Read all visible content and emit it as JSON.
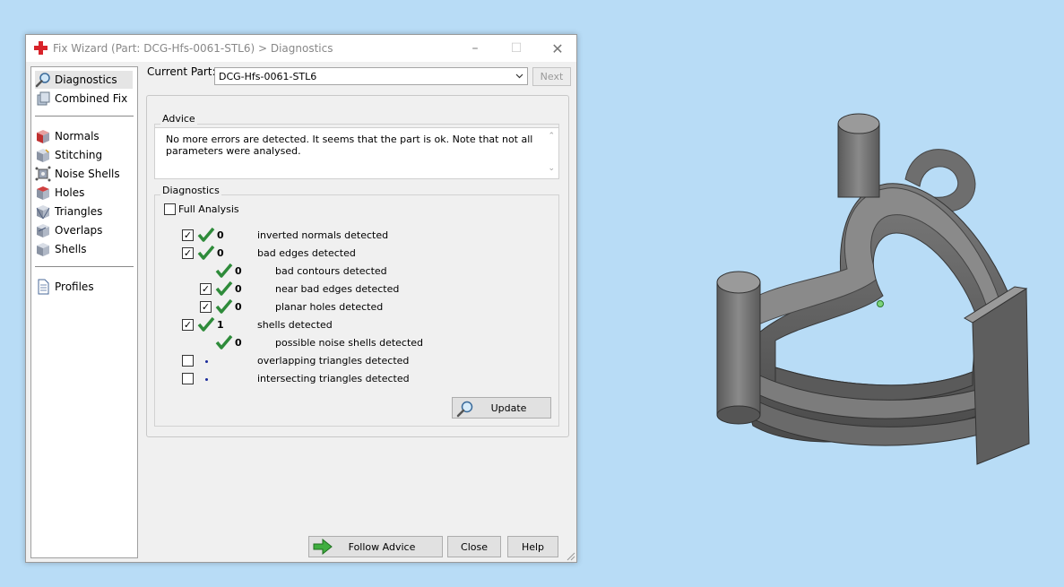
{
  "window": {
    "title": "Fix Wizard (Part: DCG-Hfs-0061-STL6) > Diagnostics",
    "minimize": "–",
    "maximize": "☐",
    "close": "✕"
  },
  "sidebar": {
    "items": [
      {
        "label": "Diagnostics",
        "icon": "magnifier-icon"
      },
      {
        "label": "Combined Fix",
        "icon": "combined-fix-icon"
      },
      {
        "label": "Normals",
        "icon": "normals-cube-icon"
      },
      {
        "label": "Stitching",
        "icon": "stitching-cube-icon"
      },
      {
        "label": "Noise Shells",
        "icon": "noise-shells-icon"
      },
      {
        "label": "Holes",
        "icon": "holes-cube-icon"
      },
      {
        "label": "Triangles",
        "icon": "triangles-cube-icon"
      },
      {
        "label": "Overlaps",
        "icon": "overlaps-cube-icon"
      },
      {
        "label": "Shells",
        "icon": "shells-cube-icon"
      },
      {
        "label": "Profiles",
        "icon": "document-icon"
      }
    ]
  },
  "current_part": {
    "label": "Current Part:",
    "value": "DCG-Hfs-0061-STL6",
    "next_label": "Next"
  },
  "advice": {
    "title": "Advice",
    "text": "No more errors are detected. It seems that the part is ok. Note that not all parameters were analysed."
  },
  "diagnostics": {
    "title": "Diagnostics",
    "full_analysis_label": "Full Analysis",
    "rows": [
      {
        "checked": true,
        "status": "ok",
        "value": "0",
        "label": "inverted normals detected"
      },
      {
        "checked": true,
        "status": "ok",
        "value": "0",
        "label": "bad edges detected"
      },
      {
        "checkbox": false,
        "status": "ok",
        "value": "0",
        "label": "bad contours detected"
      },
      {
        "checked": true,
        "status": "ok",
        "value": "0",
        "label": "near bad edges detected"
      },
      {
        "checked": true,
        "status": "ok",
        "value": "0",
        "label": "planar holes detected"
      },
      {
        "checked": true,
        "status": "ok",
        "value": "1",
        "label": "shells detected"
      },
      {
        "checkbox": false,
        "status": "ok",
        "value": "0",
        "label": "possible noise shells detected"
      },
      {
        "checked": false,
        "status": "pending",
        "value": "",
        "label": "overlapping triangles detected"
      },
      {
        "checked": false,
        "status": "pending",
        "value": "",
        "label": "intersecting triangles detected"
      }
    ],
    "update_label": "Update"
  },
  "footer": {
    "follow_advice_label": "Follow Advice",
    "close_label": "Close",
    "help_label": "Help"
  },
  "colors": {
    "background": "#b8dcf6",
    "check_green": "#2e8b3a",
    "pending_dot": "#1a2a9a",
    "model_gray": "#6e6e6e"
  }
}
